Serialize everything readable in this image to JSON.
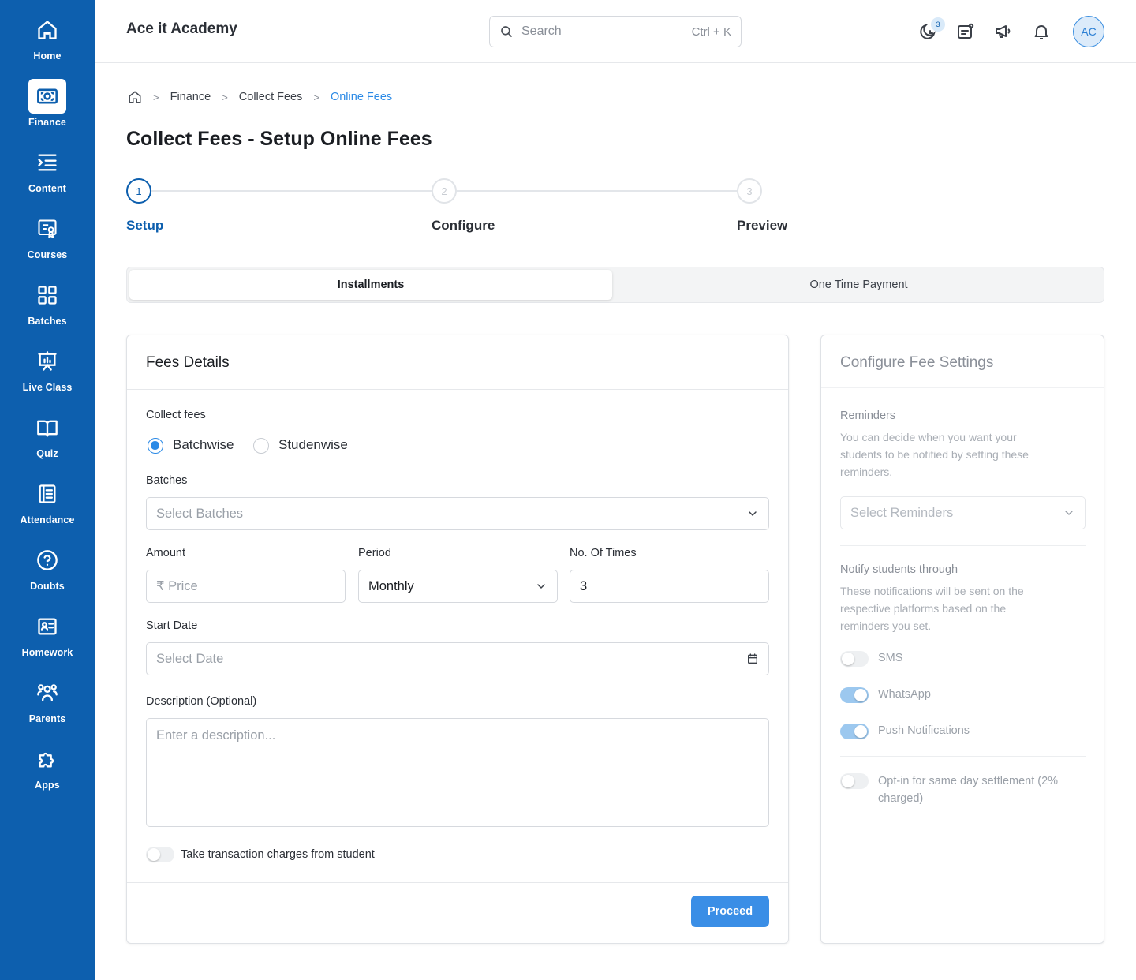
{
  "sidebar": {
    "items": [
      {
        "label": "Home",
        "icon": "home-icon"
      },
      {
        "label": "Finance",
        "icon": "banknote-icon",
        "active": true
      },
      {
        "label": "Content",
        "icon": "list-indent-icon"
      },
      {
        "label": "Courses",
        "icon": "certificate-icon"
      },
      {
        "label": "Batches",
        "icon": "grid-icon"
      },
      {
        "label": "Live Class",
        "icon": "presentation-chart-icon"
      },
      {
        "label": "Quiz",
        "icon": "open-book-icon"
      },
      {
        "label": "Attendance",
        "icon": "notebook-icon"
      },
      {
        "label": "Doubts",
        "icon": "question-circle-icon"
      },
      {
        "label": "Homework",
        "icon": "id-card-icon"
      },
      {
        "label": "Parents",
        "icon": "people-group-icon"
      },
      {
        "label": "Apps",
        "icon": "puzzle-icon"
      }
    ]
  },
  "header": {
    "title": "Ace it Academy",
    "search_placeholder": "Search",
    "search_shortcut": "Ctrl + K",
    "notification_badge": "3",
    "avatar_initials": "AC"
  },
  "breadcrumb": {
    "items": [
      "Finance",
      "Collect Fees",
      "Online Fees"
    ]
  },
  "page": {
    "title": "Collect Fees - Setup Online Fees"
  },
  "stepper": {
    "steps": [
      {
        "number": "1",
        "label": "Setup",
        "active": true
      },
      {
        "number": "2",
        "label": "Configure"
      },
      {
        "number": "3",
        "label": "Preview"
      }
    ]
  },
  "tabs": {
    "items": [
      "Installments",
      "One Time Payment"
    ],
    "active": "Installments"
  },
  "fees_details": {
    "title": "Fees Details",
    "collect_fees_label": "Collect fees",
    "options": [
      "Batchwise",
      "Studenwise"
    ],
    "selected_option": "Batchwise",
    "batches_label": "Batches",
    "batches_placeholder": "Select Batches",
    "amount_label": "Amount",
    "amount_placeholder": "₹ Price",
    "period_label": "Period",
    "period_value": "Monthly",
    "times_label": "No. Of Times",
    "times_value": "3",
    "start_date_label": "Start Date",
    "start_date_placeholder": "Select Date",
    "description_label": "Description (Optional)",
    "description_placeholder": "Enter a description...",
    "transaction_toggle_label": "Take transaction charges from student",
    "transaction_toggle_on": false,
    "proceed_label": "Proceed"
  },
  "configure": {
    "title": "Configure Fee Settings",
    "reminders_label": "Reminders",
    "reminders_desc": "You can decide when you want your students to be notified by setting these reminders.",
    "reminders_placeholder": "Select Reminders",
    "notify_label": "Notify students through",
    "notify_desc": "These notifications will be sent on the respective platforms based on the reminders you set.",
    "toggles": [
      {
        "label": "SMS",
        "on": false
      },
      {
        "label": "WhatsApp",
        "on": true
      },
      {
        "label": "Push Notifications",
        "on": true
      }
    ],
    "settlement_label": "Opt-in for same day settlement (2% charged)",
    "settlement_on": false
  },
  "colors": {
    "sidebar": "#0d5fae",
    "accent": "#2b8ae6",
    "primary_button": "#3a8ee6"
  }
}
